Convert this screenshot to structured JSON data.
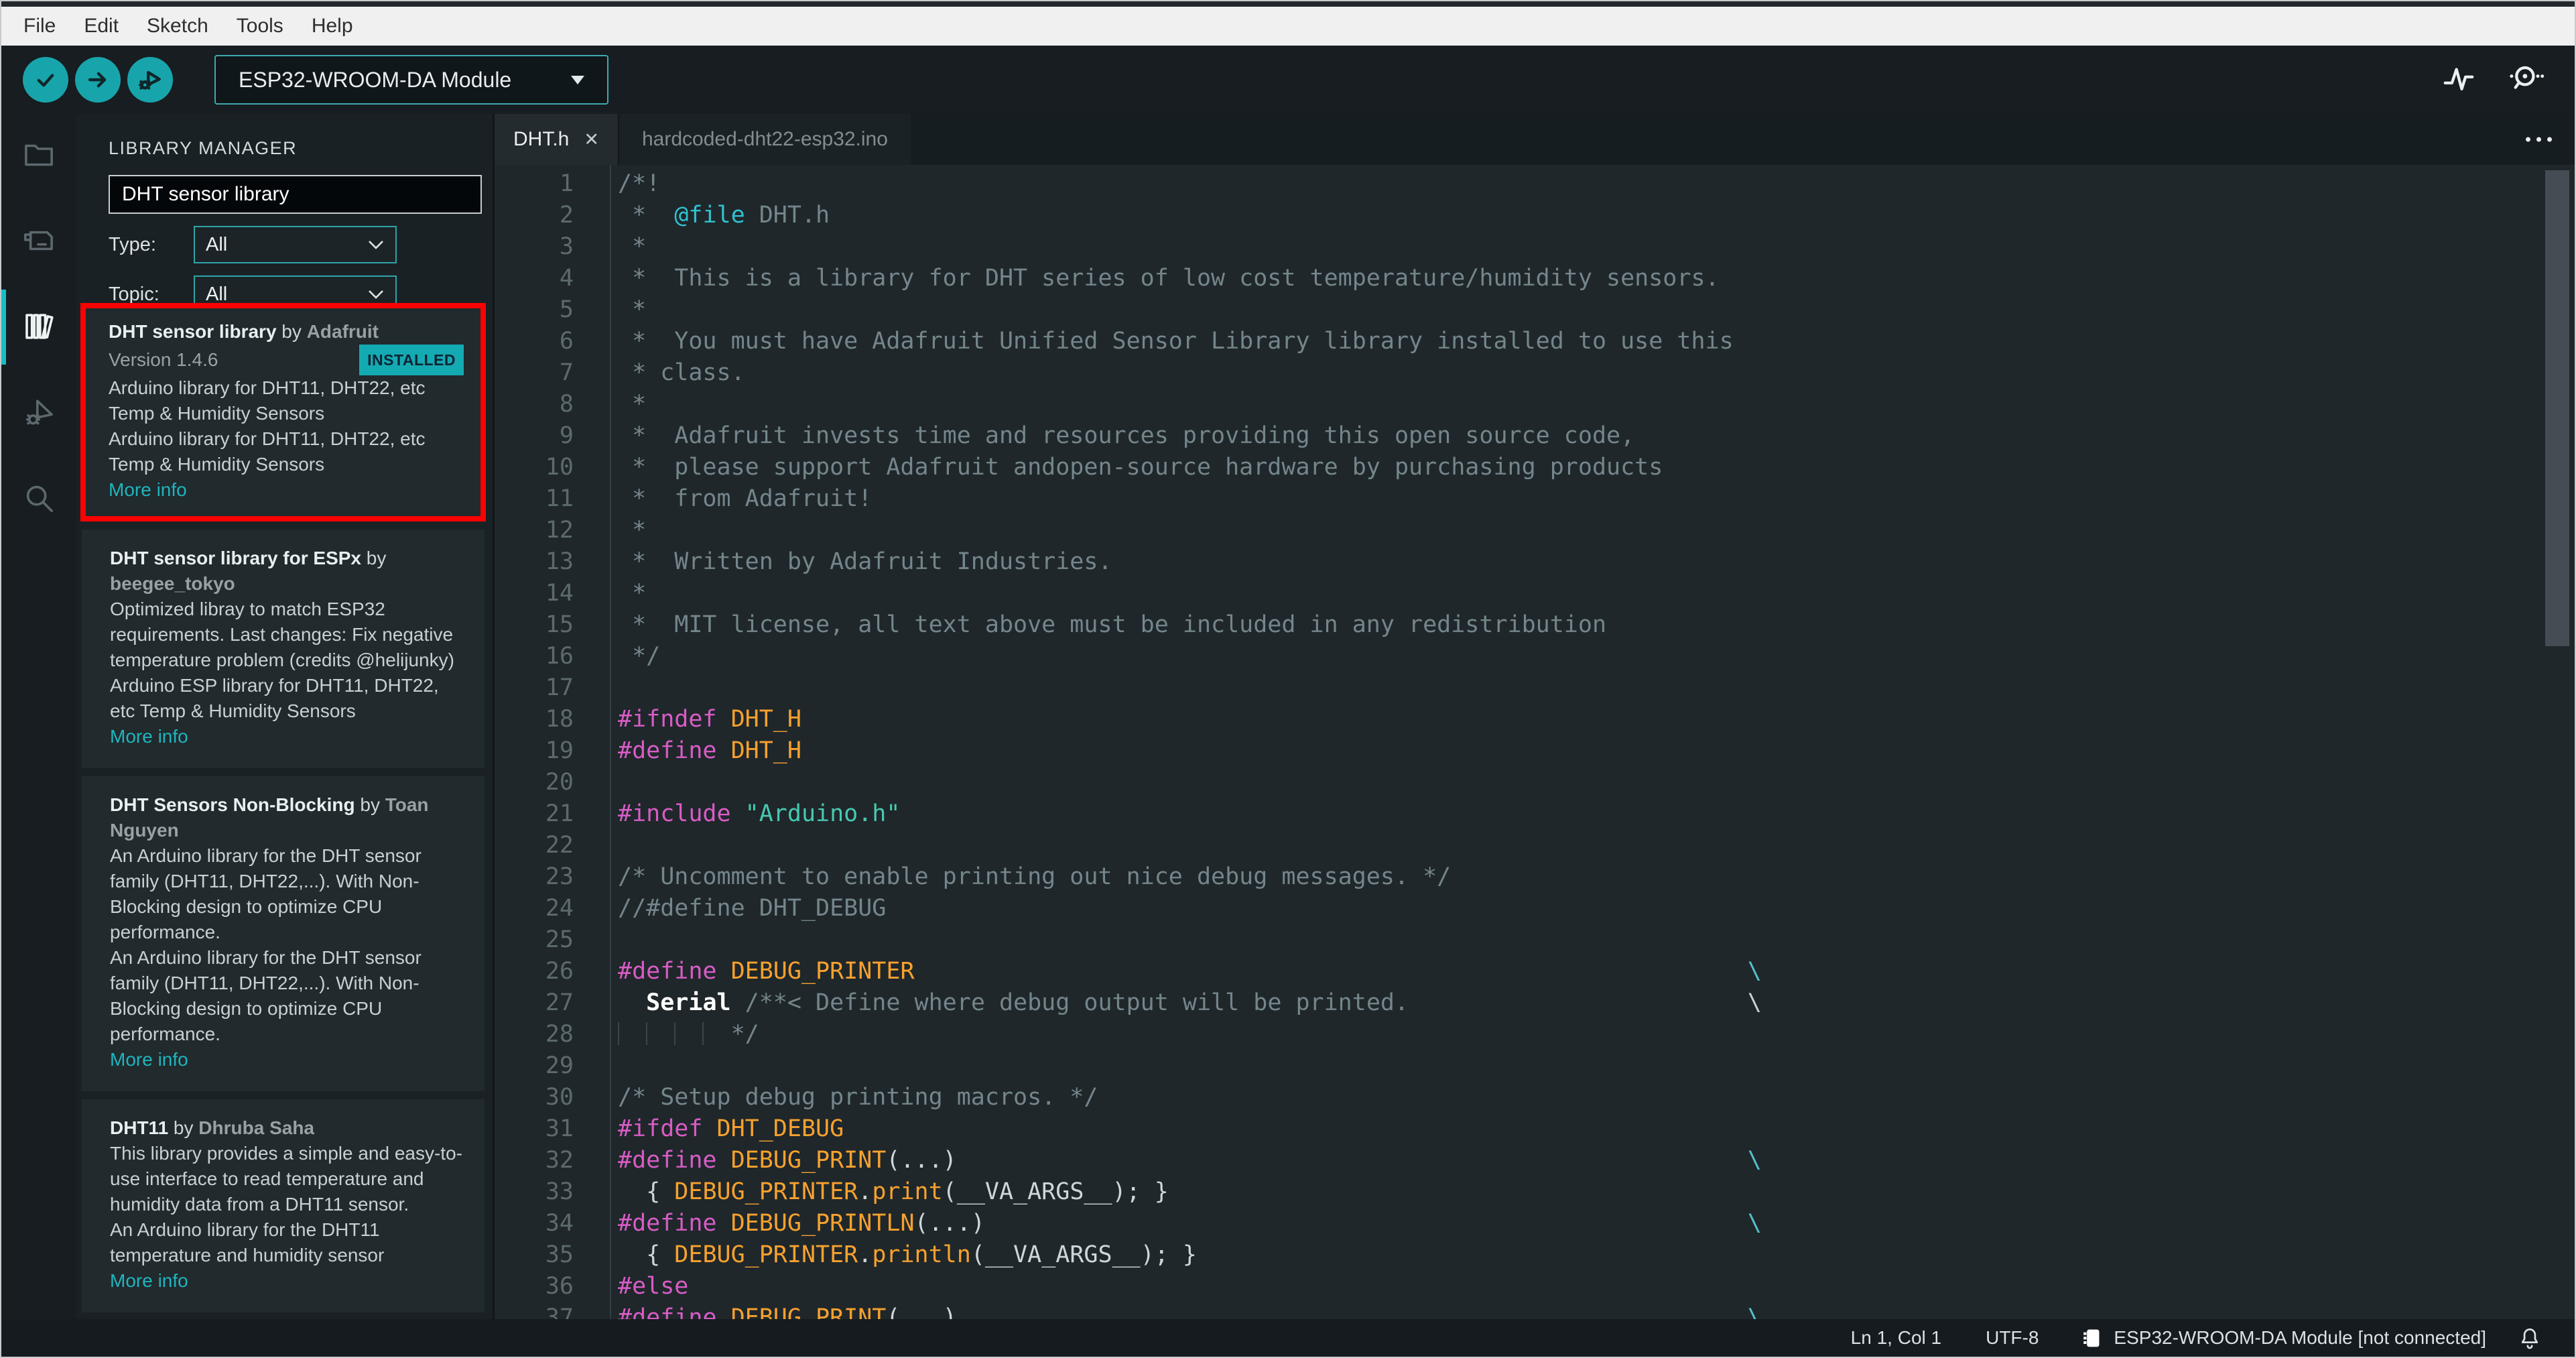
{
  "menu_bar": {
    "items": [
      "File",
      "Edit",
      "Sketch",
      "Tools",
      "Help"
    ]
  },
  "toolbar": {
    "buttons": [
      {
        "icon": "check-icon"
      },
      {
        "icon": "arrow-right-icon"
      },
      {
        "icon": "debug-icon"
      }
    ],
    "board_selector_value": "ESP32-WROOM-DA Module",
    "right_icons": [
      "serial-plotter-icon",
      "serial-monitor-icon"
    ]
  },
  "sidebar": {
    "items": [
      {
        "icon": "folder-icon",
        "active": false
      },
      {
        "icon": "board-icon",
        "active": false
      },
      {
        "icon": "books-icon",
        "active": true
      },
      {
        "icon": "bug-icon",
        "active": false
      },
      {
        "icon": "search-icon",
        "active": false
      }
    ]
  },
  "library_manager": {
    "title": "LIBRARY MANAGER",
    "search_value": "DHT sensor library",
    "type_label": "Type:",
    "type_value": "All",
    "topic_label": "Topic:",
    "topic_value": "All",
    "items": [
      {
        "name": "DHT sensor library",
        "by": " by ",
        "author": "Adafruit",
        "version": "Version 1.4.6",
        "badge": "INSTALLED",
        "description": [
          "Arduino library for DHT11, DHT22, etc Temp & Humidity Sensors",
          "Arduino library for DHT11, DHT22, etc Temp & Humidity Sensors"
        ],
        "link": "More info",
        "highlighted": true
      },
      {
        "name": "DHT sensor library for ESPx",
        "by": " by ",
        "author": "beegee_tokyo",
        "description": [
          "Optimized libray to match ESP32 requirements. Last changes: Fix negative temperature problem (credits @helijunky)",
          "Arduino ESP library for DHT11, DHT22, etc Temp & Humidity Sensors"
        ],
        "link": "More info",
        "highlighted": false
      },
      {
        "name": "DHT Sensors Non-Blocking",
        "by": " by ",
        "author": "Toan Nguyen",
        "description": [
          "An Arduino library for the DHT sensor family (DHT11, DHT22,...). With Non-Blocking design to optimize CPU performance.",
          "An Arduino library for the DHT sensor family (DHT11, DHT22,...). With Non-Blocking design to optimize CPU performance."
        ],
        "link": "More info",
        "highlighted": false
      },
      {
        "name": "DHT11",
        "by": " by ",
        "author": "Dhruba Saha",
        "description": [
          "This library provides a simple and easy-to-use interface to read temperature and humidity data from a DHT11 sensor.",
          "An Arduino library for the DHT11 temperature and humidity sensor"
        ],
        "link": "More info",
        "highlighted": false
      }
    ]
  },
  "editor": {
    "tabs": [
      {
        "label": "DHT.h",
        "active": true,
        "close_glyph": "✕"
      },
      {
        "label": "hardcoded-dht22-esp32.ino",
        "active": false
      }
    ],
    "lines": [
      [
        [
          "c",
          "/*!"
        ]
      ],
      [
        [
          "c",
          " *  "
        ],
        [
          "d",
          "@file"
        ],
        [
          "c",
          " DHT.h"
        ]
      ],
      [
        [
          "c",
          " *"
        ]
      ],
      [
        [
          "c",
          " *  This is a library for DHT series of low cost temperature/humidity sensors."
        ]
      ],
      [
        [
          "c",
          " *"
        ]
      ],
      [
        [
          "c",
          " *  You must have Adafruit Unified Sensor Library library installed to use this"
        ]
      ],
      [
        [
          "c",
          " * class."
        ]
      ],
      [
        [
          "c",
          " *"
        ]
      ],
      [
        [
          "c",
          " *  Adafruit invests time and resources providing this open source code,"
        ]
      ],
      [
        [
          "c",
          " *  please support Adafruit andopen-source hardware by purchasing products"
        ]
      ],
      [
        [
          "c",
          " *  from Adafruit!"
        ]
      ],
      [
        [
          "c",
          " *"
        ]
      ],
      [
        [
          "c",
          " *  Written by Adafruit Industries."
        ]
      ],
      [
        [
          "c",
          " *"
        ]
      ],
      [
        [
          "c",
          " *  MIT license, all text above must be included in any redistribution"
        ]
      ],
      [
        [
          "c",
          " */"
        ]
      ],
      [],
      [
        [
          "p",
          "#ifndef"
        ],
        [
          "t",
          " "
        ],
        [
          "m",
          "DHT_H"
        ]
      ],
      [
        [
          "p",
          "#define"
        ],
        [
          "t",
          " "
        ],
        [
          "m",
          "DHT_H"
        ]
      ],
      [],
      [
        [
          "p",
          "#include"
        ],
        [
          "t",
          " "
        ],
        [
          "s",
          "\"Arduino.h\""
        ]
      ],
      [],
      [
        [
          "c",
          "/* Uncomment to enable printing out nice debug messages. */"
        ]
      ],
      [
        [
          "c",
          "//#define DHT_DEBUG"
        ]
      ],
      [],
      [
        [
          "p",
          "#define"
        ],
        [
          "t",
          " "
        ],
        [
          "m",
          "DEBUG_PRINTER"
        ],
        [
          "b",
          "\\"
        ]
      ],
      [
        [
          "t",
          "  "
        ],
        [
          "k",
          "Serial"
        ],
        [
          "c",
          " /**< Define where debug output will be printed."
        ],
        [
          "w",
          "\\"
        ]
      ],
      [
        [
          "g",
          ""
        ],
        [
          "c",
          "*/"
        ]
      ],
      [],
      [
        [
          "c",
          "/* Setup debug printing macros. */"
        ]
      ],
      [
        [
          "p",
          "#ifdef"
        ],
        [
          "t",
          " "
        ],
        [
          "m",
          "DHT_DEBUG"
        ]
      ],
      [
        [
          "p",
          "#define"
        ],
        [
          "t",
          " "
        ],
        [
          "m",
          "DEBUG_PRINT"
        ],
        [
          "t",
          "(...)"
        ],
        [
          "b",
          "\\"
        ]
      ],
      [
        [
          "t",
          "  { "
        ],
        [
          "m",
          "DEBUG_PRINTER"
        ],
        [
          "t",
          "."
        ],
        [
          "m",
          "print"
        ],
        [
          "t",
          "("
        ],
        [
          "v",
          "__VA_ARGS__"
        ],
        [
          "t",
          "); }"
        ]
      ],
      [
        [
          "p",
          "#define"
        ],
        [
          "t",
          " "
        ],
        [
          "m",
          "DEBUG_PRINTLN"
        ],
        [
          "t",
          "(...)"
        ],
        [
          "b",
          "\\"
        ]
      ],
      [
        [
          "t",
          "  { "
        ],
        [
          "m",
          "DEBUG_PRINTER"
        ],
        [
          "t",
          "."
        ],
        [
          "m",
          "println"
        ],
        [
          "t",
          "("
        ],
        [
          "v",
          "__VA_ARGS__"
        ],
        [
          "t",
          "); }"
        ]
      ],
      [
        [
          "p",
          "#else"
        ]
      ],
      [
        [
          "p",
          "#define"
        ],
        [
          "t",
          " "
        ],
        [
          "m",
          "DEBUG_PRINT"
        ],
        [
          "t",
          "(...)"
        ],
        [
          "b",
          "\\"
        ]
      ]
    ]
  },
  "status_bar": {
    "position": "Ln 1, Col 1",
    "encoding": "UTF-8",
    "board": "ESP32-WROOM-DA Module [not connected]"
  },
  "colors": {
    "accent_teal": "#17a5ab",
    "installed_badge": "#14aab2",
    "highlight_red": "#fb0200",
    "more_info_link": "#1fb5be"
  }
}
